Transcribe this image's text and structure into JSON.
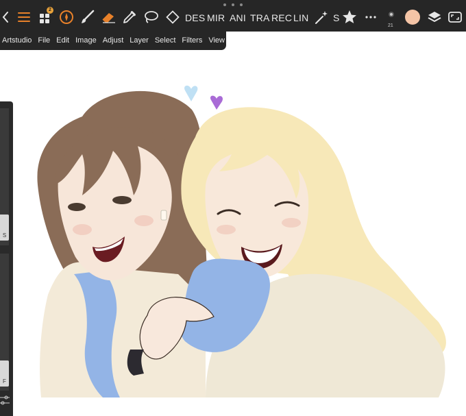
{
  "toolbar": {
    "icons": [
      "back-chevron-icon",
      "menu-icon",
      "gallery-grid-icon",
      "brush-cursor-icon",
      "brush-icon",
      "eraser-icon",
      "eyedropper-icon",
      "lasso-icon",
      "transform-icon",
      "magic-wand-icon",
      "star-icon",
      "more-icon",
      "brush-size-preview-icon",
      "color-swatch-icon",
      "layers-icon",
      "fullscreen-icon"
    ],
    "gallery_badge": "2",
    "text_buttons": [
      "DES",
      "MIR",
      "ANI",
      "TRA",
      "REC",
      "LIN"
    ],
    "symmetry_label": "S",
    "brush_size": "21",
    "accent_color": "#e8812a",
    "badge_color": "#e8a23a",
    "current_color": "#f4c4a6"
  },
  "menubar": {
    "items": [
      "Artstudio",
      "File",
      "Edit",
      "Image",
      "Adjust",
      "Layer",
      "Select",
      "Filters",
      "View"
    ]
  },
  "sidepanel": {
    "size_thumb_label": "S",
    "flow_thumb_label": "F"
  }
}
